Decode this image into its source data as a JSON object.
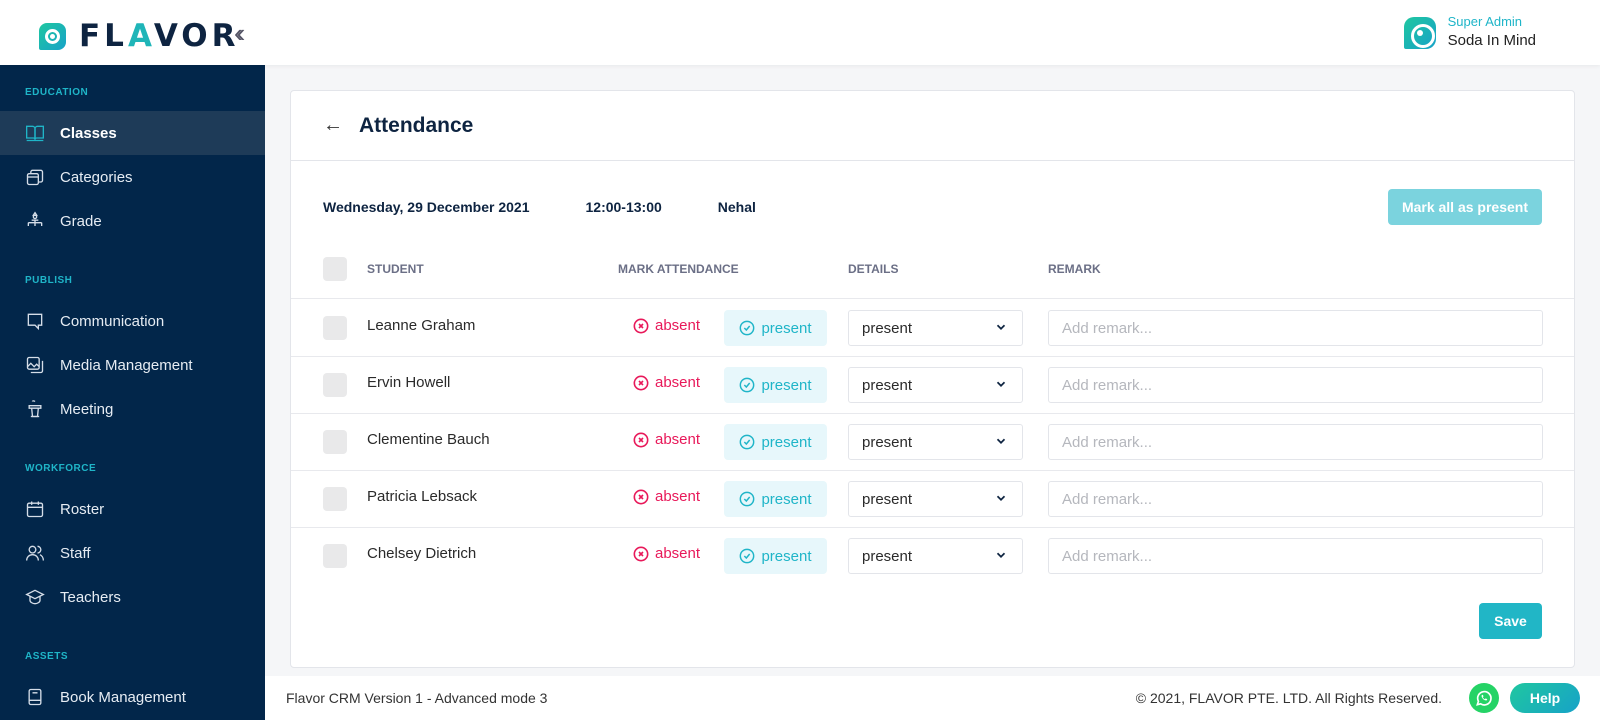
{
  "header": {
    "logo_prefix": "FL",
    "logo_accent": "A",
    "logo_suffix": "VOR",
    "collapse_icon": "chevrons-left-icon",
    "user_role": "Super Admin",
    "user_name": "Soda In Mind"
  },
  "sidebar": {
    "sections": [
      {
        "title": "EDUCATION",
        "items": [
          {
            "label": "Classes",
            "icon": "book-open-icon",
            "active": true
          },
          {
            "label": "Categories",
            "icon": "layers-icon"
          },
          {
            "label": "Grade",
            "icon": "hierarchy-icon"
          }
        ]
      },
      {
        "title": "PUBLISH",
        "items": [
          {
            "label": "Communication",
            "icon": "message-icon"
          },
          {
            "label": "Media Management",
            "icon": "image-icon"
          },
          {
            "label": "Meeting",
            "icon": "podium-icon"
          }
        ]
      },
      {
        "title": "WORKFORCE",
        "items": [
          {
            "label": "Roster",
            "icon": "calendar-icon"
          },
          {
            "label": "Staff",
            "icon": "users-icon"
          },
          {
            "label": "Teachers",
            "icon": "graduation-cap-icon"
          }
        ]
      },
      {
        "title": "ASSETS",
        "items": [
          {
            "label": "Book Management",
            "icon": "book-icon"
          }
        ]
      }
    ]
  },
  "page": {
    "title": "Attendance",
    "date": "Wednesday, 29 December 2021",
    "time": "12:00-13:00",
    "teacher": "Nehal",
    "mark_all_label": "Mark all as present",
    "save_label": "Save"
  },
  "table": {
    "columns": [
      "STUDENT",
      "MARK ATTENDANCE",
      "DETAILS",
      "REMARK"
    ],
    "absent_label": "absent",
    "present_label": "present",
    "remark_placeholder": "Add remark...",
    "rows": [
      {
        "student": "Leanne Graham",
        "details": "present",
        "remark": ""
      },
      {
        "student": "Ervin Howell",
        "details": "present",
        "remark": ""
      },
      {
        "student": "Clementine Bauch",
        "details": "present",
        "remark": ""
      },
      {
        "student": "Patricia Lebsack",
        "details": "present",
        "remark": ""
      },
      {
        "student": "Chelsey Dietrich",
        "details": "present",
        "remark": ""
      }
    ]
  },
  "footer": {
    "version": "Flavor CRM Version 1 - Advanced mode 3",
    "copyright": "© 2021, FLAVOR PTE. LTD. All Rights Reserved.",
    "help_label": "Help"
  },
  "colors": {
    "sidebar_bg": "#02264a",
    "accent": "#1fb5c8",
    "absent": "#e8195a",
    "whatsapp": "#25d366"
  }
}
